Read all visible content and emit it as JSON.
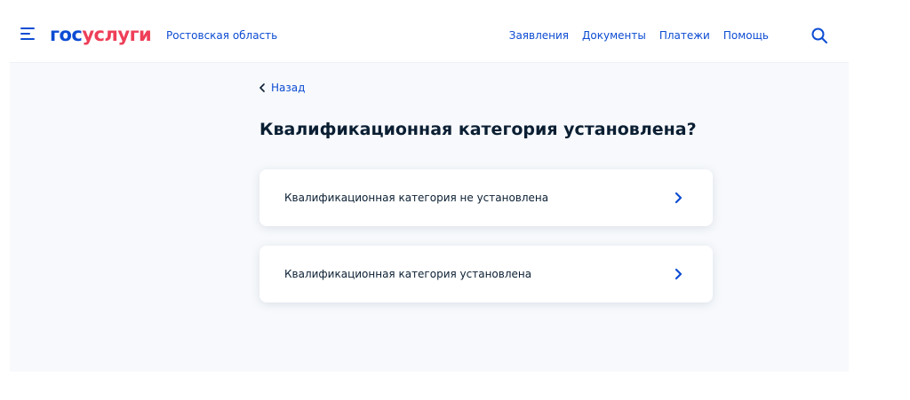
{
  "header": {
    "logo_part1": "гос",
    "logo_part2": "услуги",
    "region": "Ростовская область",
    "nav": [
      {
        "label": "Заявления"
      },
      {
        "label": "Документы"
      },
      {
        "label": "Платежи"
      },
      {
        "label": "Помощь"
      }
    ],
    "icons": {
      "menu": "menu-icon",
      "search": "search-icon"
    }
  },
  "main": {
    "back_label": "Назад",
    "title": "Квалификационная категория установлена?",
    "options": [
      {
        "label": "Квалификационная категория не установлена",
        "icon": "chevron-right-icon"
      },
      {
        "label": "Квалификационная категория установлена",
        "icon": "chevron-right-icon"
      }
    ]
  },
  "colors": {
    "primary": "#0d4cd3",
    "logo_accent": "#ee3f58",
    "text": "#0b1f33",
    "background": "#f7f9fc",
    "card": "#ffffff"
  }
}
